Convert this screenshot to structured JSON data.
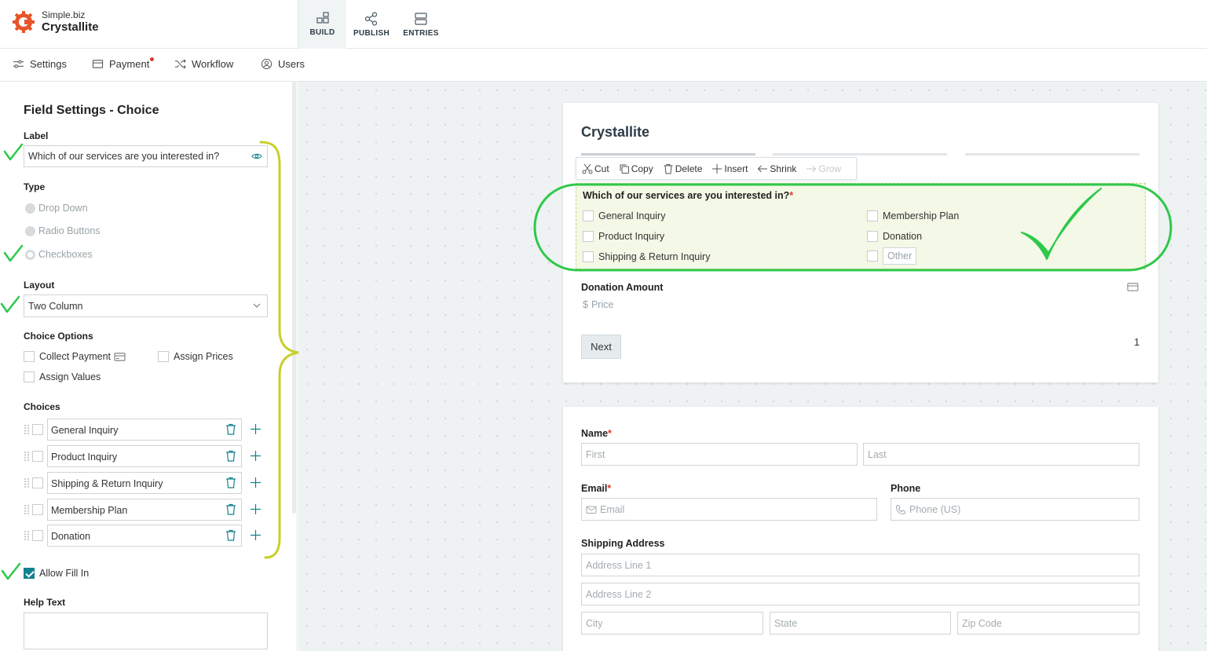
{
  "brand": {
    "subtitle": "Simple.biz",
    "name": "Crystallite"
  },
  "top_tabs": [
    {
      "label": "BUILD",
      "icon": "build-icon",
      "active": true
    },
    {
      "label": "PUBLISH",
      "icon": "share-icon",
      "active": false
    },
    {
      "label": "ENTRIES",
      "icon": "entries-icon",
      "active": false
    }
  ],
  "sub_nav": [
    {
      "label": "Settings",
      "icon": "sliders-icon"
    },
    {
      "label": "Payment",
      "icon": "card-icon"
    },
    {
      "label": "Workflow",
      "icon": "shuffle-icon"
    },
    {
      "label": "Users",
      "icon": "user-icon"
    }
  ],
  "panel": {
    "title": "Field Settings - Choice",
    "label_heading": "Label",
    "label_value": "Which of our services are you interested in?",
    "type_heading": "Type",
    "types": [
      "Drop Down",
      "Radio Buttons",
      "Checkboxes"
    ],
    "layout_heading": "Layout",
    "layout_value": "Two Column",
    "choice_options_heading": "Choice Options",
    "collect_payment": "Collect Payment",
    "assign_prices": "Assign Prices",
    "assign_values": "Assign Values",
    "choices_heading": "Choices",
    "choices": [
      "General Inquiry",
      "Product Inquiry",
      "Shipping & Return Inquiry",
      "Membership Plan",
      "Donation"
    ],
    "allow_fill_in": "Allow Fill In",
    "help_text_heading": "Help Text"
  },
  "toolbar": {
    "cut": "Cut",
    "copy": "Copy",
    "delete": "Delete",
    "insert": "Insert",
    "shrink": "Shrink",
    "grow": "Grow"
  },
  "form": {
    "title": "Crystallite",
    "question": "Which of our services are you interested in?",
    "required_mark": "*",
    "options_left": [
      "General Inquiry",
      "Product Inquiry",
      "Shipping & Return Inquiry"
    ],
    "options_right": [
      "Membership Plan",
      "Donation"
    ],
    "other_placeholder": "Other",
    "donation_label": "Donation Amount",
    "price_placeholder": "Price",
    "next_label": "Next",
    "page_number": "1"
  },
  "form2": {
    "name_label": "Name",
    "first_placeholder": "First",
    "last_placeholder": "Last",
    "email_label": "Email",
    "email_placeholder": "Email",
    "phone_label": "Phone",
    "phone_placeholder": "Phone (US)",
    "shipping_label": "Shipping Address",
    "address1_placeholder": "Address Line 1",
    "address2_placeholder": "Address Line 2",
    "city_placeholder": "City",
    "state_placeholder": "State",
    "zip_placeholder": "Zip Code"
  },
  "colors": {
    "accent": "#14818e",
    "logo": "#e8542a",
    "annotation_green": "#2ec84a",
    "brace_yellow": "#c9cf2a",
    "required_red": "#e0392b"
  }
}
